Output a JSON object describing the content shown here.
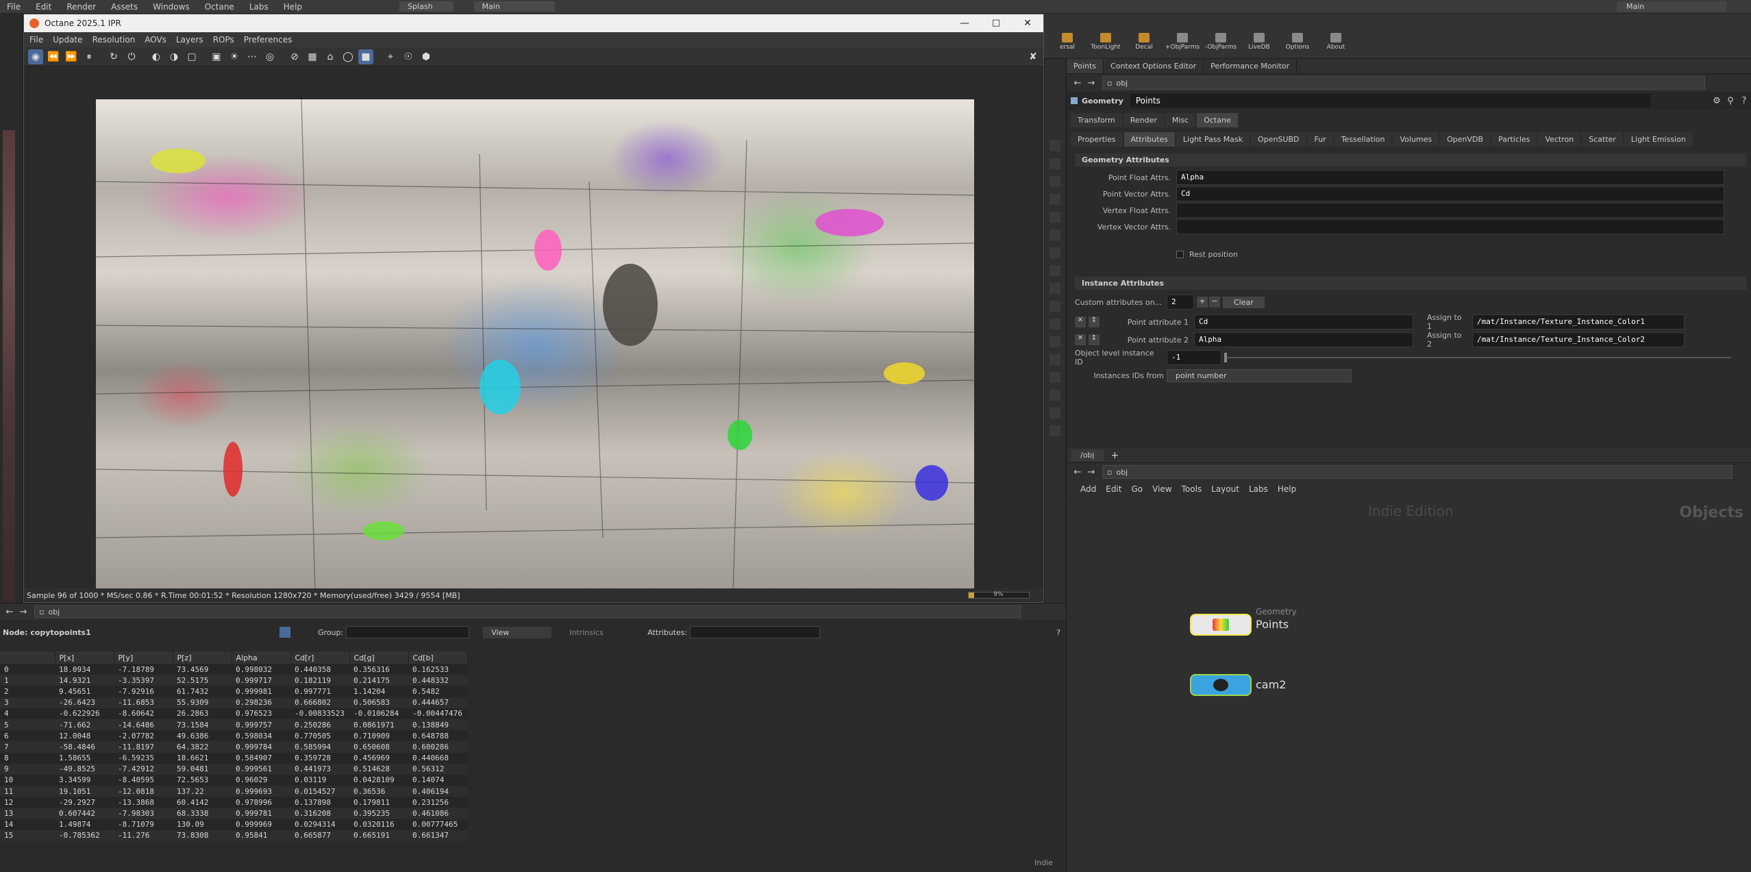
{
  "houdini": {
    "menu": [
      "File",
      "Edit",
      "Render",
      "Assets",
      "Windows",
      "Octane",
      "Labs",
      "Help"
    ],
    "desktop_tab": "Splash",
    "desktop_name": "Main",
    "right_desktop": "Main"
  },
  "shelf": {
    "items": [
      {
        "label": "ersal"
      },
      {
        "label": "ToonLight"
      },
      {
        "label": "Decal"
      },
      {
        "label": "+ObjParms"
      },
      {
        "label": "-ObjParms"
      },
      {
        "label": "LiveDB"
      },
      {
        "label": "Options"
      },
      {
        "label": "About"
      }
    ]
  },
  "octane": {
    "title": "Octane 2025.1 IPR",
    "menu": [
      "File",
      "Update",
      "Resolution",
      "AOVs",
      "Layers",
      "ROPs",
      "Preferences"
    ],
    "status": "Sample 96 of 1000 * MS/sec 0.86 * R.Time 00:01:52 * Resolution 1280x720 * Memory(used/free) 3429 / 9554 [MB]",
    "progress": 0.096,
    "progress_label": "9%"
  },
  "params": {
    "tabs": [
      "Points",
      "Context Options Editor",
      "Performance Monitor"
    ],
    "path": "obj",
    "node_type": "Geometry",
    "node_name": "Points",
    "main_tabs": [
      "Transform",
      "Render",
      "Misc",
      "Octane"
    ],
    "sub_tabs": [
      "Properties",
      "Attributes",
      "Light Pass Mask",
      "OpenSUBD",
      "Fur",
      "Tessellation",
      "Volumes",
      "OpenVDB",
      "Particles",
      "Vectron",
      "Scatter",
      "Light Emission"
    ],
    "geo_attr_header": "Geometry Attributes",
    "point_float_label": "Point Float Attrs.",
    "point_float_value": "Alpha",
    "point_vector_label": "Point Vector Attrs.",
    "point_vector_value": "Cd",
    "vertex_float_label": "Vertex Float Attrs.",
    "vertex_vector_label": "Vertex Vector Attrs.",
    "rest_position_label": "Rest position",
    "instance_header": "Instance Attributes",
    "custom_attrs_label": "Custom attributes on...",
    "custom_attrs_value": "2",
    "clear_label": "Clear",
    "pa1_label": "Point attribute 1",
    "pa1_value": "Cd",
    "assign1_label": "Assign to 1",
    "assign1_value": "/mat/Instance/Texture_Instance_Color1",
    "pa2_label": "Point attribute 2",
    "pa2_value": "Alpha",
    "assign2_label": "Assign to 2",
    "assign2_value": "/mat/Instance/Texture_Instance_Color2",
    "object_id_label": "Object level instance ID",
    "object_id_value": "-1",
    "ids_from_label": "Instances IDs from",
    "ids_from_value": "point number"
  },
  "network": {
    "tab": "/obj",
    "path": "obj",
    "menu": [
      "Add",
      "Edit",
      "Go",
      "View",
      "Tools",
      "Layout",
      "Labs",
      "Help"
    ],
    "watermark": "Indie Edition",
    "context_label": "Objects",
    "nodes": [
      {
        "type": "Geometry",
        "name": "Points"
      },
      {
        "type": "",
        "name": "cam2"
      }
    ]
  },
  "spreadsheet": {
    "path": "obj",
    "node_label": "Node: copytopoints1",
    "group_label": "Group:",
    "view_label": "View",
    "intrinsics_label": "Intrinsics",
    "attributes_label": "Attributes:",
    "indie": "Indie",
    "columns": [
      "",
      "P[x]",
      "P[y]",
      "P[z]",
      "Alpha",
      "Cd[r]",
      "Cd[g]",
      "Cd[b]"
    ],
    "rows": [
      [
        "0",
        "18.0934",
        "-7.18789",
        "73.4569",
        "0.998032",
        "0.440358",
        "0.356316",
        "0.162533"
      ],
      [
        "1",
        "14.9321",
        "-3.35397",
        "52.5175",
        "0.999717",
        "0.182119",
        "0.214175",
        "0.448332"
      ],
      [
        "2",
        "9.45651",
        "-7.92916",
        "61.7432",
        "0.999981",
        "0.997771",
        "1.14204",
        "0.5482"
      ],
      [
        "3",
        "-26.6423",
        "-11.6853",
        "55.9309",
        "0.298236",
        "0.666802",
        "0.506583",
        "0.444657"
      ],
      [
        "4",
        "-0.622926",
        "-8.60642",
        "26.2863",
        "0.976523",
        "-0.00833523",
        "-0.0106284",
        "-0.00447476"
      ],
      [
        "5",
        "-71.662",
        "-14.6486",
        "73.1584",
        "0.999757",
        "0.250286",
        "0.0861971",
        "0.138849"
      ],
      [
        "6",
        "12.0048",
        "-2.07782",
        "49.6386",
        "0.598034",
        "0.770505",
        "0.710909",
        "0.648788"
      ],
      [
        "7",
        "-58.4846",
        "-11.8197",
        "64.3822",
        "0.999784",
        "0.585994",
        "0.650608",
        "0.600286"
      ],
      [
        "8",
        "1.58655",
        "-6.59235",
        "18.6621",
        "0.584907",
        "0.359728",
        "0.456969",
        "0.440668"
      ],
      [
        "9",
        "-49.8525",
        "-7.42912",
        "59.0481",
        "0.999561",
        "0.441973",
        "0.514628",
        "0.56312"
      ],
      [
        "10",
        "3.34599",
        "-8.40595",
        "72.5653",
        "0.96029",
        "0.03119",
        "0.0428109",
        "0.14074"
      ],
      [
        "11",
        "19.1051",
        "-12.0818",
        "137.22",
        "0.999693",
        "0.0154527",
        "0.36536",
        "0.406194"
      ],
      [
        "12",
        "-29.2927",
        "-13.3868",
        "60.4142",
        "0.978996",
        "0.137898",
        "0.179811",
        "0.231256"
      ],
      [
        "13",
        "0.607442",
        "-7.98303",
        "68.3338",
        "0.999781",
        "0.316208",
        "0.395235",
        "0.461086"
      ],
      [
        "14",
        "1.49874",
        "-8.71079",
        "130.09",
        "0.999969",
        "0.0294314",
        "0.0320116",
        "0.00777465"
      ],
      [
        "15",
        "-0.785362",
        "-11.276",
        "73.8308",
        "0.95841",
        "0.665877",
        "0.665191",
        "0.661347"
      ]
    ]
  },
  "icons": {
    "octane_logo": "octane-logo-icon",
    "close": "close-icon",
    "minimize": "minimize-icon",
    "maximize": "maximize-icon"
  }
}
